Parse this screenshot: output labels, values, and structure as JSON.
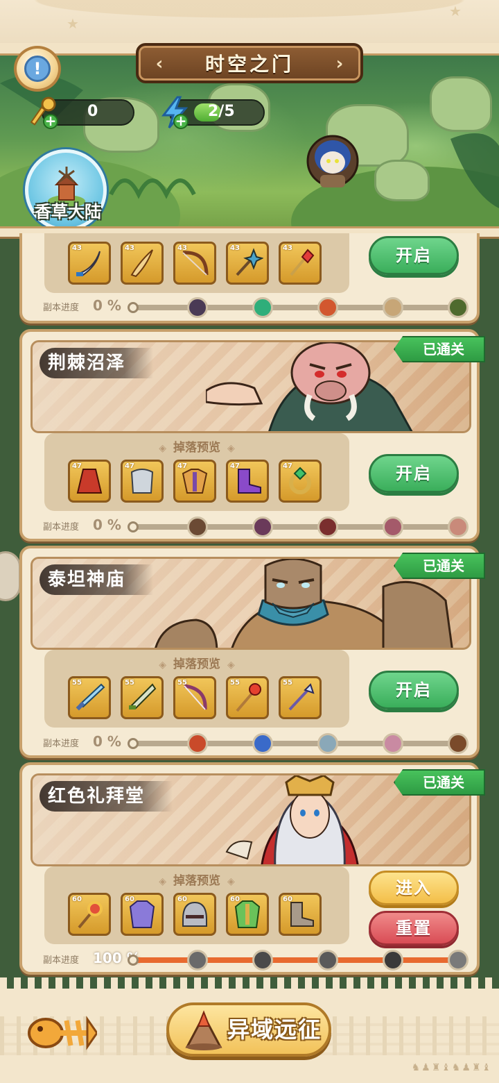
{
  "header": {
    "title": "时空之门",
    "keys_count": "0",
    "energy_text": "2/5",
    "energy_fraction": 0.4,
    "region_name": "香草大陆"
  },
  "dungeons": [
    {
      "id": "partial",
      "name": "",
      "cleared_label": "",
      "drop_title": "",
      "item_levels": [
        "43",
        "43",
        "43",
        "43",
        "43"
      ],
      "item_icons": [
        "curved-sword-icon",
        "fang-dagger-icon",
        "bow-icon",
        "shuriken-staff-icon",
        "ruby-wand-icon"
      ],
      "button": "开启",
      "progress_label": "副本进度",
      "progress_value": "0 %",
      "progress_fraction": 0
    },
    {
      "id": "thorn-swamp",
      "name": "荆棘沼泽",
      "cleared_label": "已通关",
      "drop_title": "掉落预览",
      "item_levels": [
        "47",
        "47",
        "47",
        "47",
        "47"
      ],
      "item_icons": [
        "red-cloak-icon",
        "steel-chestplate-icon",
        "gold-armor-icon",
        "purple-boots-icon",
        "emerald-ring-icon"
      ],
      "button": "开启",
      "progress_label": "副本进度",
      "progress_value": "0 %",
      "progress_fraction": 0
    },
    {
      "id": "titan-temple",
      "name": "泰坦神庙",
      "cleared_label": "已通关",
      "drop_title": "掉落预览",
      "item_levels": [
        "55",
        "55",
        "55",
        "55",
        "55"
      ],
      "item_icons": [
        "crystal-sword-icon",
        "green-blade-icon",
        "scythe-bow-icon",
        "fire-staff-icon",
        "crystal-spear-icon"
      ],
      "button": "开启",
      "progress_label": "副本进度",
      "progress_value": "0 %",
      "progress_fraction": 0
    },
    {
      "id": "red-chapel",
      "name": "红色礼拜堂",
      "cleared_label": "已通关",
      "drop_title": "掉落预览",
      "item_levels": [
        "60",
        "60",
        "60",
        "60",
        "60"
      ],
      "item_icons": [
        "sun-scepter-icon",
        "purple-coat-icon",
        "iron-helmet-icon",
        "green-armor-icon",
        "war-boots-icon"
      ],
      "button_enter": "进入",
      "button_reset": "重置",
      "progress_label": "副本进度",
      "progress_value": "100 %",
      "progress_fraction": 1
    }
  ],
  "footer": {
    "expedition_label": "异域远征"
  },
  "colors": {
    "primary_green": "#3aae5b",
    "progress_orange": "#e86a2f",
    "cleared_green": "#2e9b43",
    "reset_red": "#d94c55",
    "enter_yellow": "#f3be48"
  }
}
